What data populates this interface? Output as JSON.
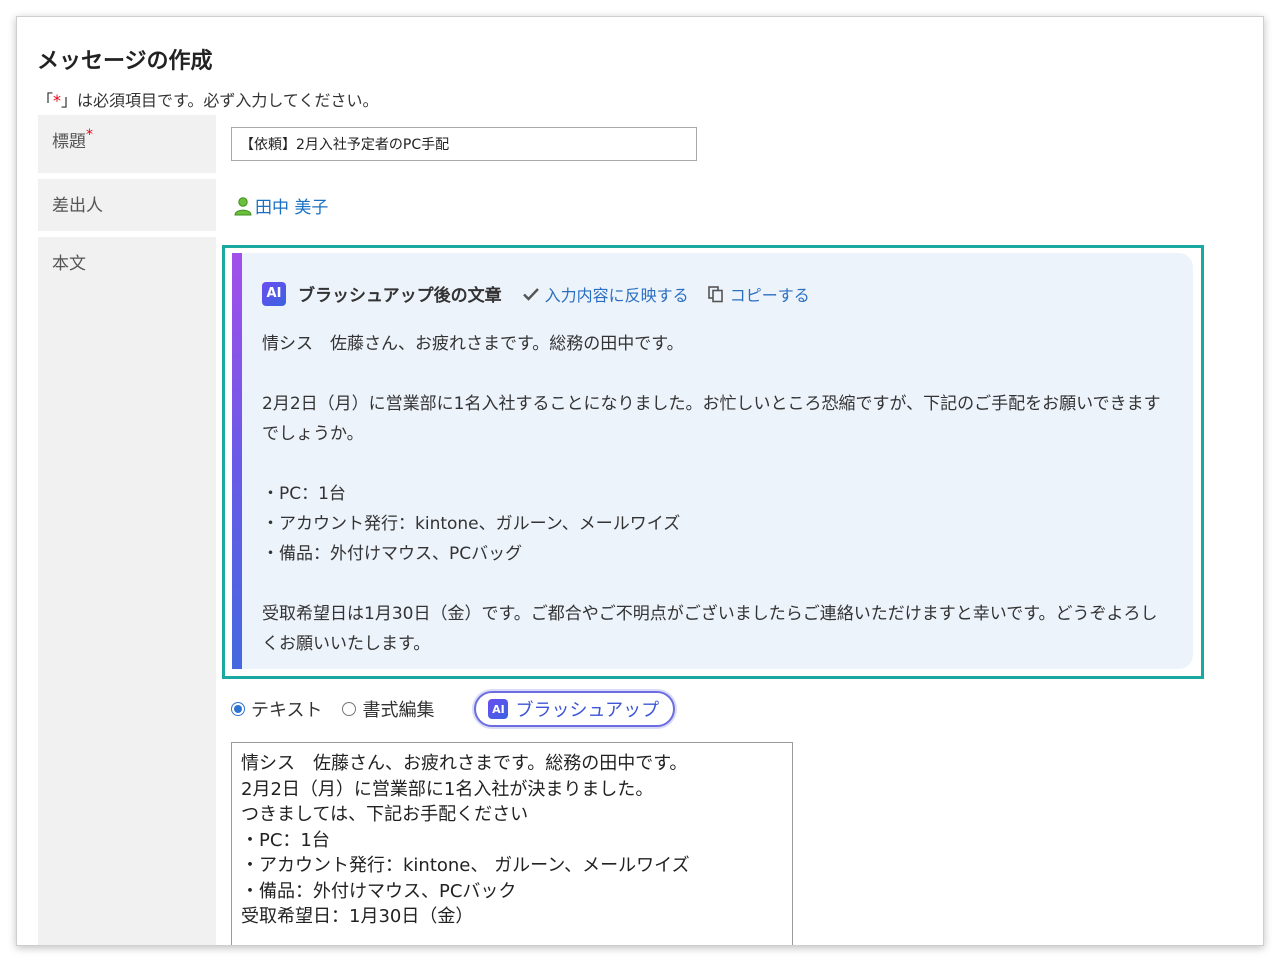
{
  "page": {
    "title": "メッセージの作成",
    "notice_prefix": "「",
    "notice_asterisk": "*",
    "notice_suffix": "」は必須項目です。必ず入力してください。"
  },
  "form": {
    "subject_label": "標題",
    "required_mark": "*",
    "subject_value": "【依頼】2月入社予定者のPC手配",
    "sender_label": "差出人",
    "sender_name": "田中 美子",
    "body_label": "本文"
  },
  "ai_panel": {
    "badge": "AI",
    "title": "ブラッシュアップ後の文章",
    "apply_label": "入力内容に反映する",
    "copy_label": "コピーする",
    "paragraphs": [
      "情シス　佐藤さん、お疲れさまです。総務の田中です。",
      "2月2日（月）に営業部に1名入社することになりました。お忙しいところ恐縮ですが、下記のご手配をお願いできますでしょうか。",
      "・PC：1台",
      "・アカウント発行：kintone、ガルーン、メールワイズ",
      "・備品：外付けマウス、PCバッグ",
      "受取希望日は1月30日（金）です。ご都合やご不明点がございましたらご連絡いただけますと幸いです。どうぞよろしくお願いいたします。"
    ]
  },
  "editor": {
    "mode_text": "テキスト",
    "mode_rich": "書式編集",
    "selected_mode": "テキスト",
    "brushup_badge": "AI",
    "brushup_label": "ブラッシュアップ",
    "lines": [
      "情シス　佐藤さん、お疲れさまです。総務の田中です。",
      "2月2日（月）に営業部に1名入社が決まりました。",
      "つきましては、下記お手配ください",
      "・PC：1台",
      "・アカウント発行：kintone、 ガルーン、メールワイズ",
      "・備品：外付けマウス、PCバック",
      "受取希望日：1月30日（金）"
    ]
  },
  "colors": {
    "link": "#1a6fc2",
    "required": "#e60012",
    "highlight_border": "#1aa9a0",
    "ai_panel_bg": "#edf3fb"
  }
}
